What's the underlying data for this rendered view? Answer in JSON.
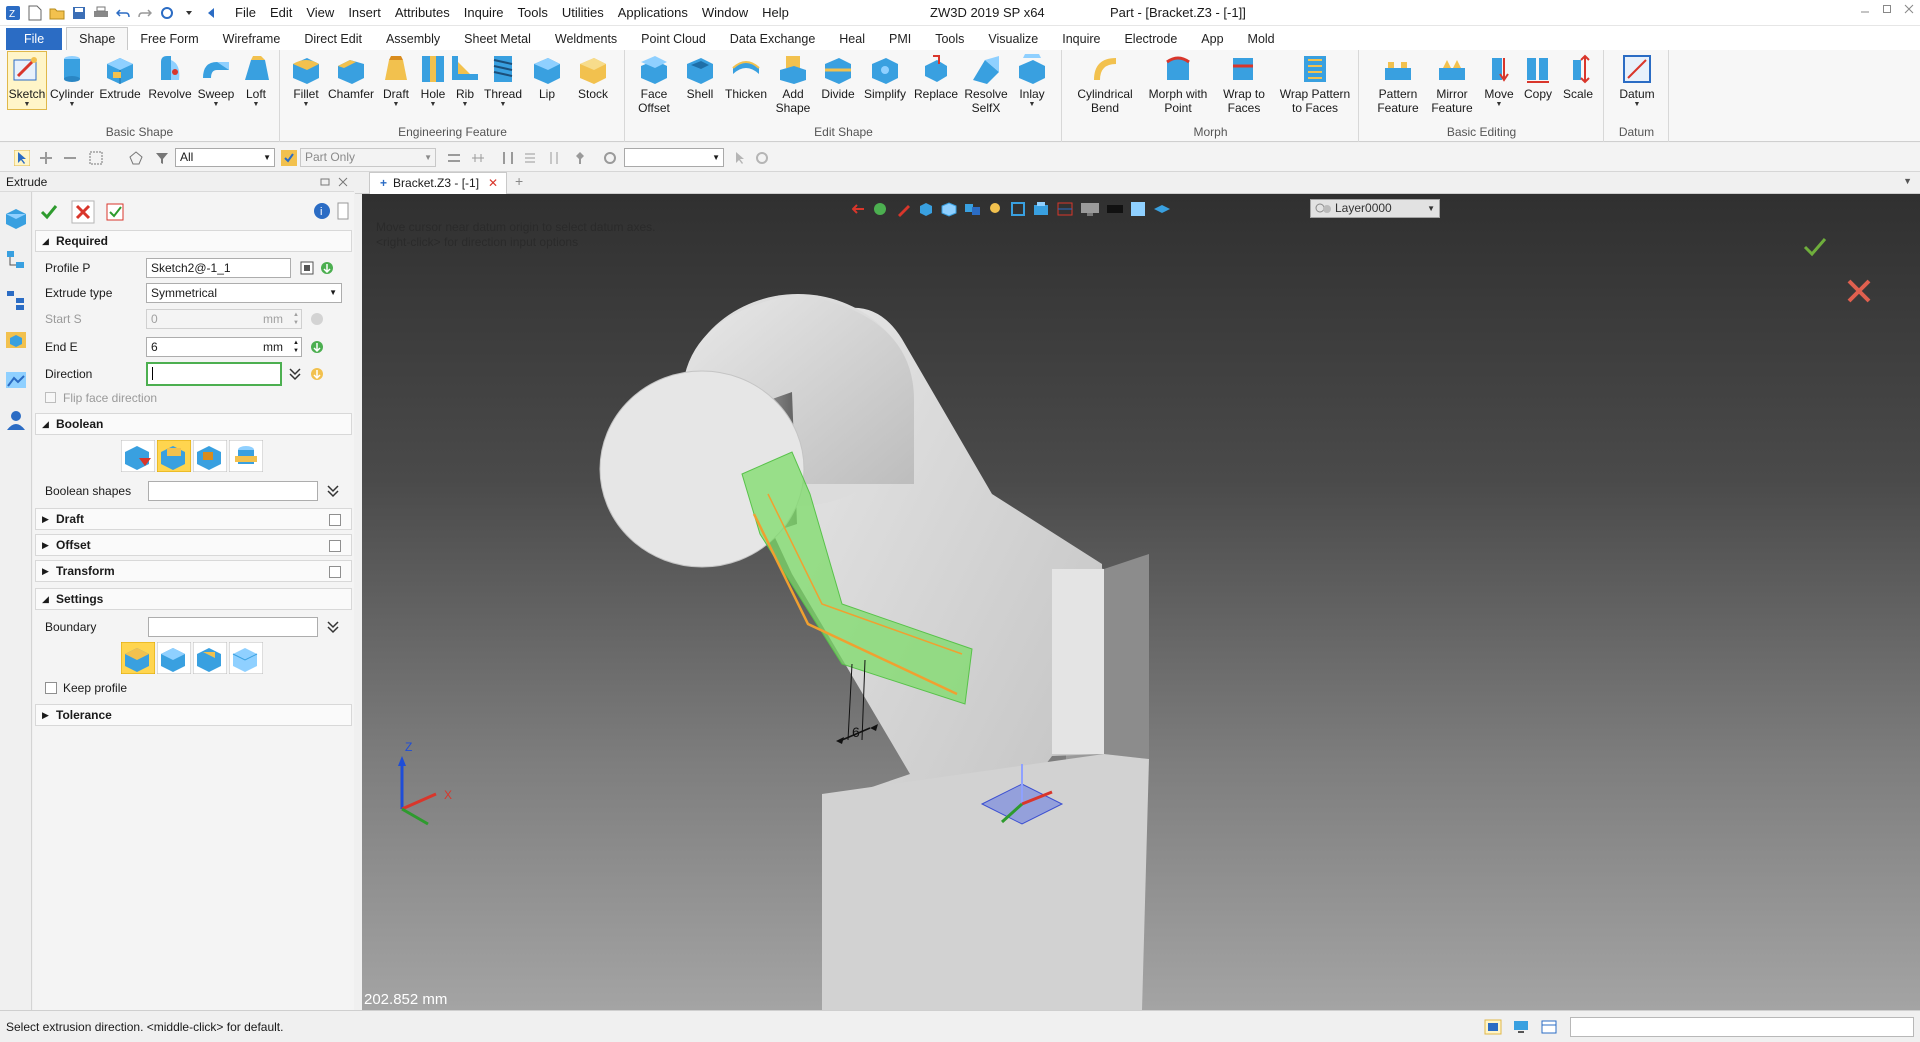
{
  "titlebar": {
    "app_title": "ZW3D 2019 SP x64",
    "doc_title": "Part - [Bracket.Z3 - [-1]]",
    "menus": [
      "File",
      "Edit",
      "View",
      "Insert",
      "Attributes",
      "Inquire",
      "Tools",
      "Utilities",
      "Applications",
      "Window",
      "Help"
    ]
  },
  "ribbon_tabs": [
    "File",
    "Shape",
    "Free Form",
    "Wireframe",
    "Direct Edit",
    "Assembly",
    "Sheet Metal",
    "Weldments",
    "Point Cloud",
    "Data Exchange",
    "Heal",
    "PMI",
    "Tools",
    "Visualize",
    "Inquire",
    "Electrode",
    "App",
    "Mold"
  ],
  "active_tab": "Shape",
  "ribbon": {
    "basic_shape": {
      "label": "Basic Shape",
      "buttons": [
        "Sketch",
        "Cylinder",
        "Extrude",
        "Revolve",
        "Sweep",
        "Loft"
      ]
    },
    "engineering_feature": {
      "label": "Engineering Feature",
      "buttons": [
        "Fillet",
        "Chamfer",
        "Draft",
        "Hole",
        "Rib",
        "Thread",
        "Lip",
        "Stock"
      ]
    },
    "edit_shape": {
      "label": "Edit Shape",
      "buttons": [
        {
          "l1": "Face",
          "l2": "Offset"
        },
        {
          "l1": "Shell",
          "l2": ""
        },
        {
          "l1": "Thicken",
          "l2": ""
        },
        {
          "l1": "Add",
          "l2": "Shape"
        },
        {
          "l1": "Divide",
          "l2": ""
        },
        {
          "l1": "Simplify",
          "l2": ""
        },
        {
          "l1": "Replace",
          "l2": ""
        },
        {
          "l1": "Resolve",
          "l2": "SelfX"
        },
        {
          "l1": "Inlay",
          "l2": ""
        }
      ]
    },
    "morph": {
      "label": "Morph",
      "buttons": [
        {
          "l1": "Cylindrical",
          "l2": "Bend"
        },
        {
          "l1": "Morph with",
          "l2": "Point"
        },
        {
          "l1": "Wrap to",
          "l2": "Faces"
        },
        {
          "l1": "Wrap Pattern",
          "l2": "to Faces"
        }
      ]
    },
    "basic_editing": {
      "label": "Basic Editing",
      "buttons": [
        {
          "l1": "Pattern",
          "l2": "Feature"
        },
        {
          "l1": "Mirror",
          "l2": "Feature"
        },
        {
          "l1": "Move",
          "l2": ""
        },
        {
          "l1": "Copy",
          "l2": ""
        },
        {
          "l1": "Scale",
          "l2": ""
        }
      ]
    },
    "datum": {
      "label": "Datum",
      "buttons": [
        "Datum"
      ]
    }
  },
  "toolbar": {
    "filter_value": "All",
    "scope_value": "Part Only",
    "empty_value": ""
  },
  "panel": {
    "title": "Extrude",
    "required": {
      "header": "Required",
      "profile_label": "Profile P",
      "profile_value": "Sketch2@-1_1",
      "extrude_type_label": "Extrude type",
      "extrude_type_value": "Symmetrical",
      "start_label": "Start S",
      "start_value": "0",
      "start_unit": "mm",
      "end_label": "End E",
      "end_value": "6",
      "end_unit": "mm",
      "direction_label": "Direction",
      "direction_value": "",
      "flip_label": "Flip face direction"
    },
    "boolean": {
      "header": "Boolean",
      "shapes_label": "Boolean shapes"
    },
    "draft_header": "Draft",
    "offset_header": "Offset",
    "transform_header": "Transform",
    "settings": {
      "header": "Settings",
      "boundary_label": "Boundary",
      "keep_profile_label": "Keep profile"
    },
    "tolerance_header": "Tolerance"
  },
  "document": {
    "tab_label": "Bracket.Z3 - [-1]",
    "hint_line1": "Move cursor near datum origin to select datum axes.",
    "hint_line2": "<right-click> for direction input options",
    "layer": "Layer0000",
    "measurement": "202.852 mm",
    "dimension_value": "6",
    "axis_z": "Z",
    "axis_x": "X"
  },
  "status": {
    "text": "Select extrusion direction.  <middle-click> for default."
  },
  "colors": {
    "file_tab": "#2b6cc4",
    "accent_green": "#4caf50",
    "preview_green": "#7ddc6a",
    "cancel_red": "#d9362b"
  }
}
